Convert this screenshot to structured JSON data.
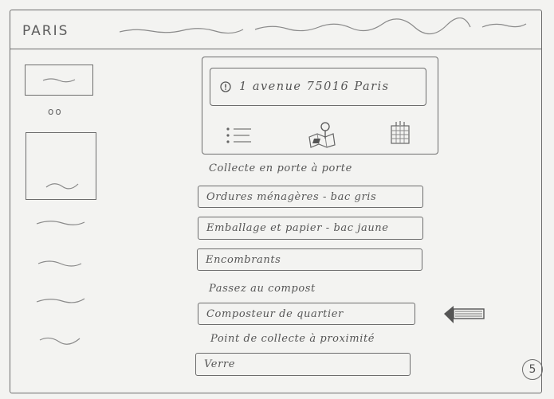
{
  "header": {
    "title": "PARIS"
  },
  "address_card": {
    "address": "1 avenue 75016 Paris"
  },
  "sections": {
    "door_to_door": "Collecte en porte à porte",
    "compost": "Passez au compost",
    "proximity": "Point de collecte à proximité"
  },
  "buttons": {
    "household_waste": "Ordures ménagères - bac gris",
    "packaging_paper": "Emballage et papier - bac jaune",
    "bulky_items": "Encombrants",
    "neighborhood_composter": "Composteur de quartier",
    "glass": "Verre"
  },
  "sidebar": {
    "mark": "oo"
  },
  "page": {
    "number": "5"
  },
  "icons": {
    "address_pin": "pin-icon",
    "list_view": "list-icon",
    "map_view": "map-icon",
    "calendar_view": "calendar-icon",
    "annotation": "arrow-icon"
  }
}
